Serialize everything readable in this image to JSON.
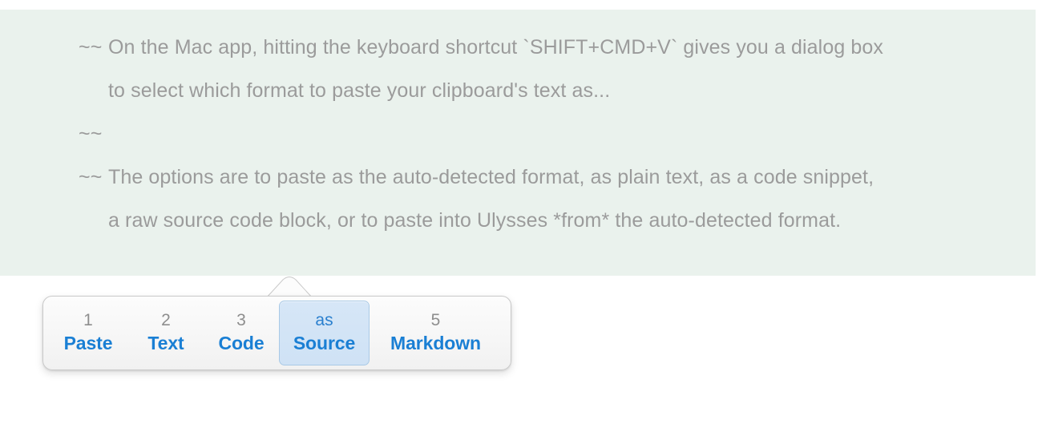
{
  "editor": {
    "background_color": "#eaf2ed",
    "text_color": "#9b9b9b",
    "paragraphs": [
      {
        "marker": "~~",
        "text": "On the Mac app, hitting the keyboard shortcut `SHIFT+CMD+V` gives you a dialog box to select which format to paste your clipboard's text as..."
      },
      {
        "marker": "~~",
        "text": ""
      },
      {
        "marker": "~~",
        "text": "The options are to paste as the auto-detected format, as plain text, as a code snippet, a raw source code block, or to paste into Ulysses *from* the auto-detected format."
      }
    ]
  },
  "popup": {
    "name": "paste-format-popup",
    "accent_color": "#1a7fd4",
    "key_color": "#8e8e8e",
    "selected_background": "#cfe2f5",
    "selected_border": "#a9c9e6",
    "selected_index": 3,
    "items": [
      {
        "key": "1",
        "label": "Paste",
        "selected": false
      },
      {
        "key": "2",
        "label": "Text",
        "selected": false
      },
      {
        "key": "3",
        "label": "Code",
        "selected": false
      },
      {
        "key": "as",
        "label": "Source",
        "selected": true
      },
      {
        "key": "5",
        "label": "Markdown",
        "selected": false
      }
    ]
  }
}
